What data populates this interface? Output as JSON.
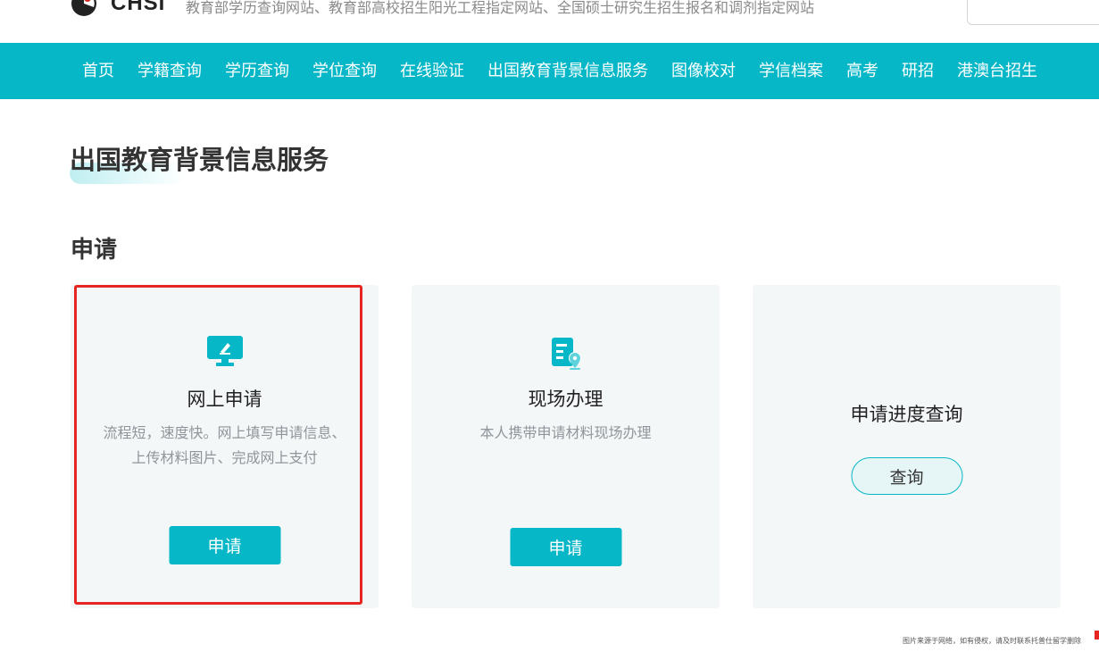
{
  "header": {
    "logo_text": "CHSI",
    "tagline": "教育部学历查询网站、教育部高校招生阳光工程指定网站、全国硕士研究生招生报名和调剂指定网站"
  },
  "nav": {
    "items": [
      "首页",
      "学籍查询",
      "学历查询",
      "学位查询",
      "在线验证",
      "出国教育背景信息服务",
      "图像校对",
      "学信档案",
      "高考",
      "研招",
      "港澳台招生"
    ]
  },
  "main": {
    "page_title": "出国教育背景信息服务",
    "section_title": "申请",
    "cards": [
      {
        "title": "网上申请",
        "description": "流程短，速度快。网上填写申请信息、上传材料图片、完成网上支付",
        "button": "申请",
        "icon": "computer-edit-icon"
      },
      {
        "title": "现场办理",
        "description": "本人携带申请材料现场办理",
        "button": "申请",
        "icon": "document-location-icon"
      },
      {
        "title": "申请进度查询",
        "button": "查询"
      }
    ]
  },
  "footer": {
    "watermark": "图片来源于网络，如有侵权，请及时联系托普仕留学删除"
  },
  "colors": {
    "accent": "#06b7c7",
    "highlight": "#e52622",
    "card_bg": "#f4f7f8"
  }
}
